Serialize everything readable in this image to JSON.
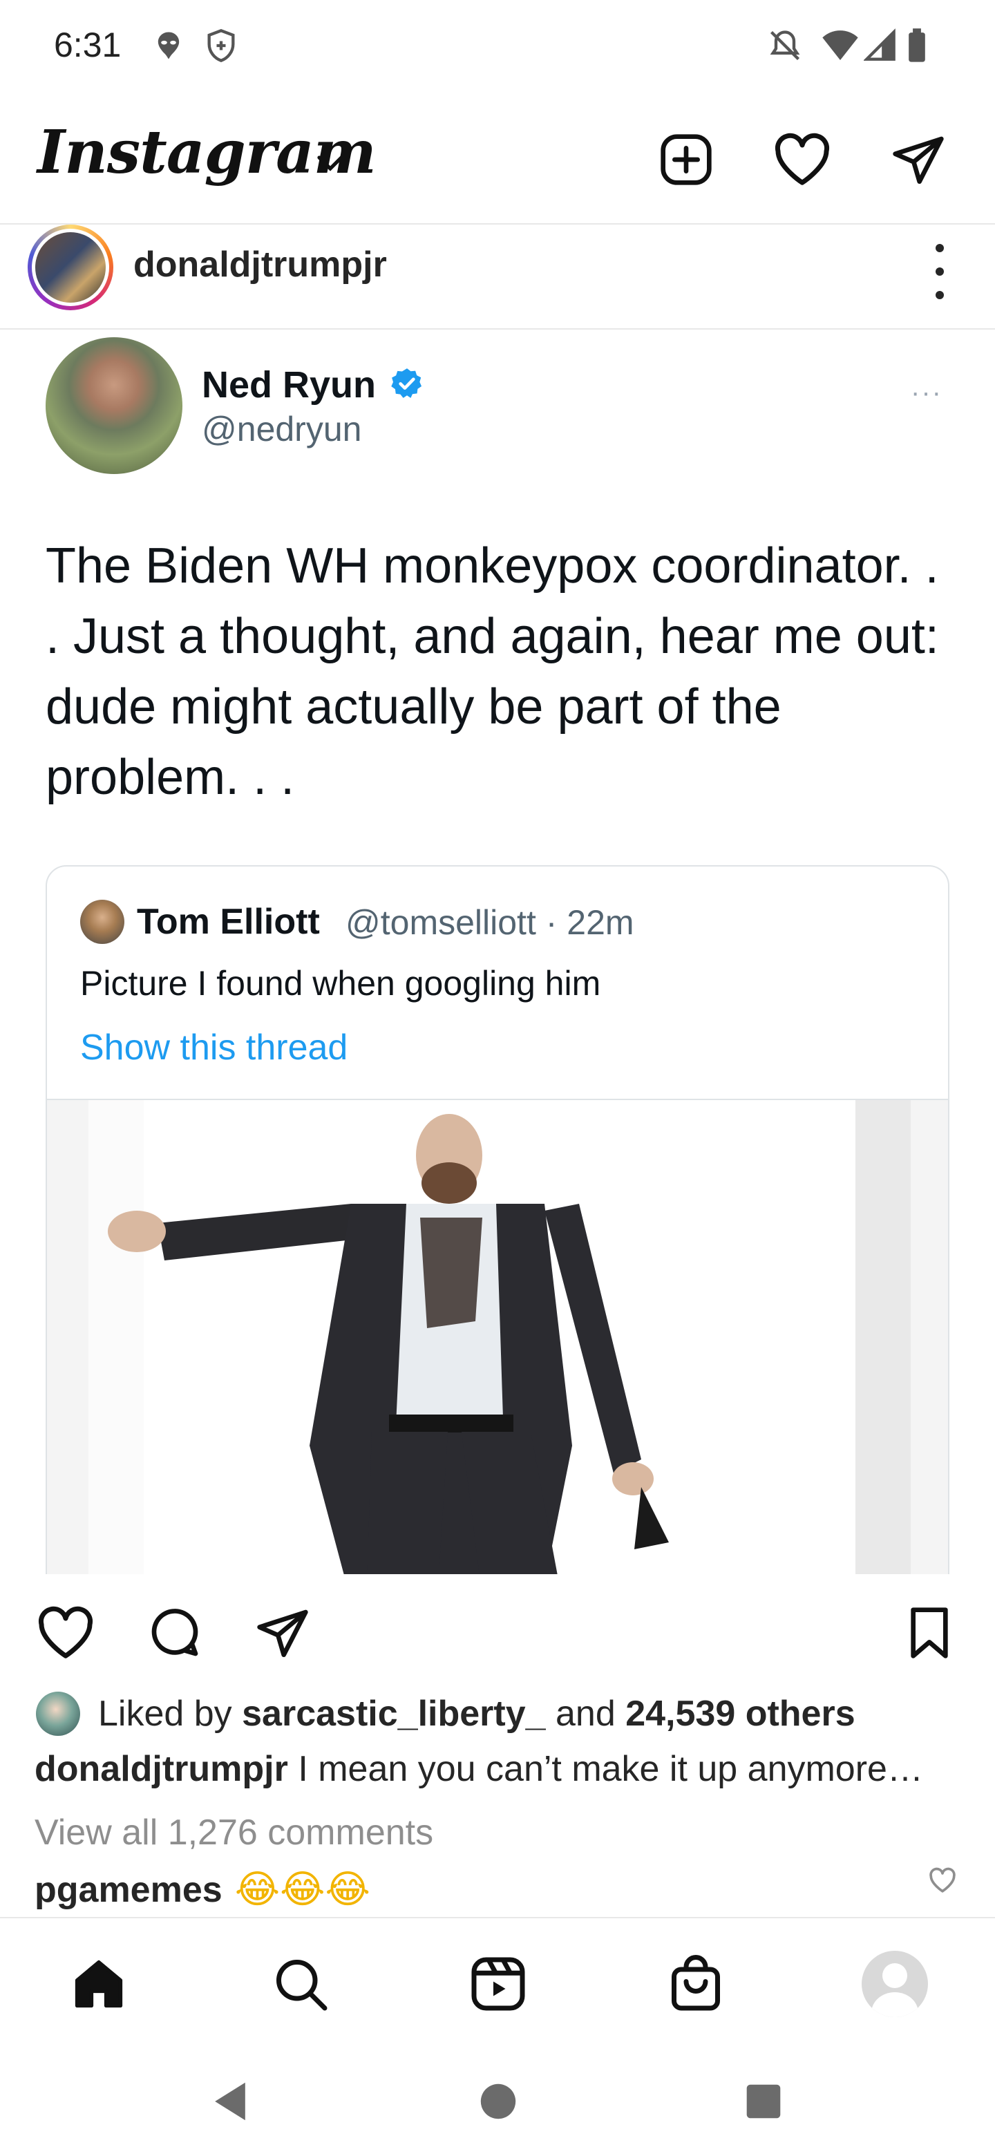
{
  "status_bar": {
    "time": "6:31"
  },
  "header": {
    "logo": "Instagram",
    "icons": [
      "plus-square-icon",
      "heart-icon",
      "send-icon"
    ]
  },
  "post": {
    "username": "donaldjtrumpjr"
  },
  "tweet": {
    "name": "Ned Ryun",
    "handle": "@nedryun",
    "more": "···",
    "text": "The Biden WH monkeypox coordinator. . . Just a thought, and again, hear me out: dude might actually be part of the problem. . .",
    "quote": {
      "name": "Tom Elliott",
      "meta": "@tomselliott · 22m",
      "text": "Picture I found when googling him",
      "link": "Show this thread"
    }
  },
  "engagement": {
    "liked_by_prefix": "Liked by ",
    "liked_by_user": "sarcastic_liberty_",
    "liked_by_mid": " and ",
    "liked_by_count": "24,539 others",
    "caption_user": "donaldjtrumpjr",
    "caption_text": " I mean you can’t make it up anymore…",
    "view_comments": "View all 1,276 comments",
    "comment_user": "pgamemes",
    "comment_text": "😂😂😂"
  },
  "colors": {
    "twitter_blue": "#1d9bf0",
    "muted": "#8e8e8e",
    "text": "#262626"
  }
}
